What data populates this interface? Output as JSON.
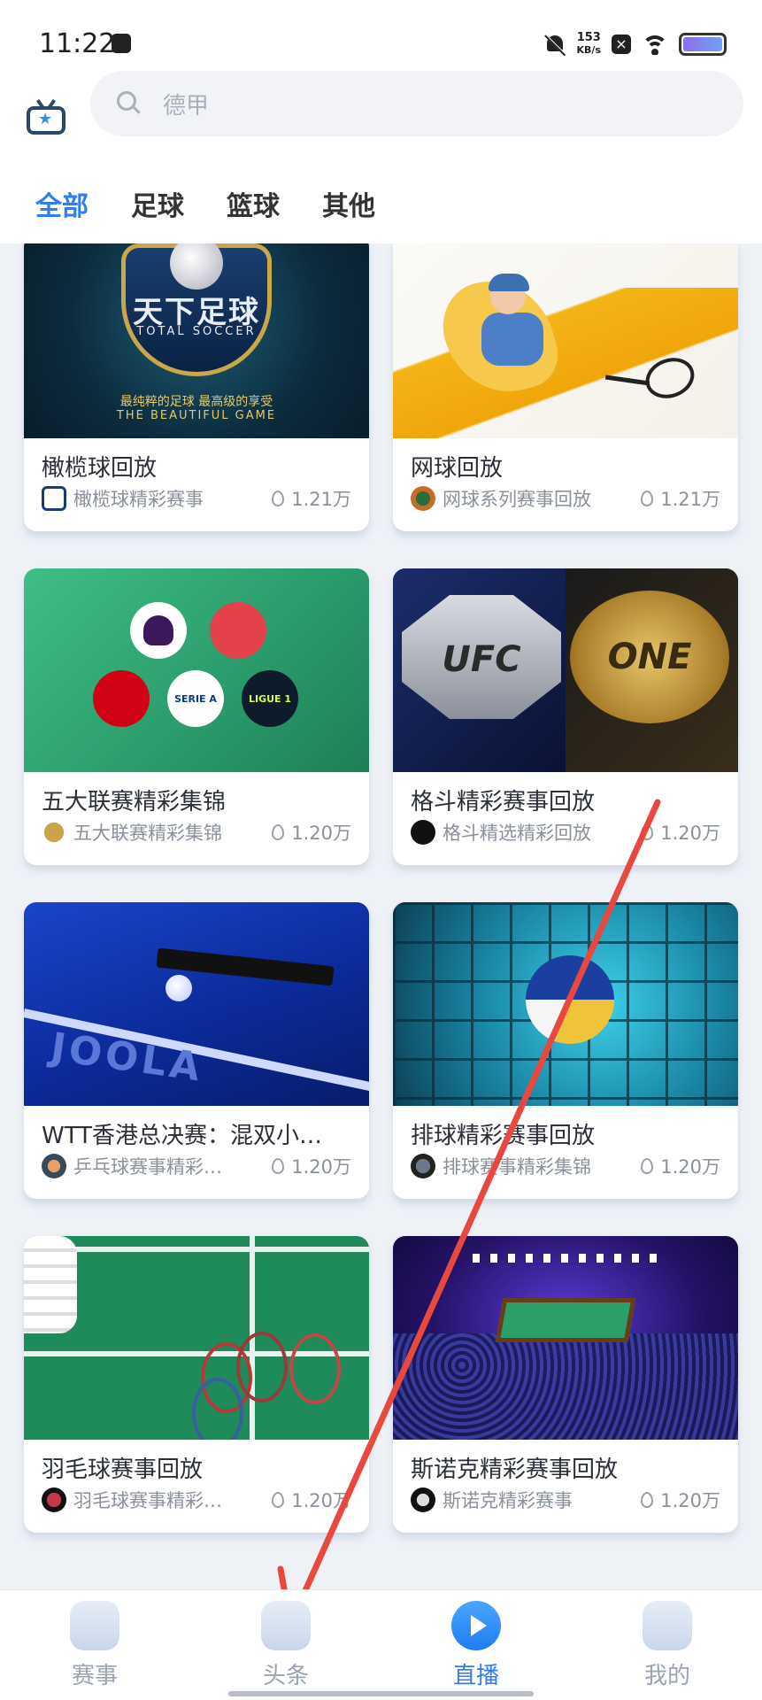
{
  "status_bar": {
    "time": "11:22",
    "speed_value": "153",
    "speed_unit": "KB/s"
  },
  "search": {
    "placeholder": "德甲"
  },
  "tabs": [
    {
      "label": "全部",
      "active": true
    },
    {
      "label": "足球",
      "active": false
    },
    {
      "label": "篮球",
      "active": false
    },
    {
      "label": "其他",
      "active": false
    }
  ],
  "cards": [
    {
      "title": "橄榄球回放",
      "source": "橄榄球精彩赛事",
      "heat": "1.21万",
      "image_text": {
        "main": "天下足球",
        "sub": "最纯粹的足球 最高级的享受",
        "en": "THE BEAUTIFUL GAME",
        "logo": "TOTAL SOCCER"
      }
    },
    {
      "title": "网球回放",
      "source": "网球系列赛事回放",
      "heat": "1.21万"
    },
    {
      "title": "五大联赛精彩集锦",
      "source": "五大联赛精彩集锦",
      "heat": "1.20万",
      "image_text": {
        "seriea": "SERIE A",
        "ligue": "LIGUE 1"
      }
    },
    {
      "title": "格斗精彩赛事回放",
      "source": "格斗精选精彩回放",
      "heat": "1.20万",
      "image_text": {
        "left": "UFC",
        "right": "ONE"
      }
    },
    {
      "title": "WTT香港总决赛：混双小…",
      "source": "乒乓球赛事精彩…",
      "heat": "1.20万",
      "image_text": {
        "brand": "JOOLA"
      }
    },
    {
      "title": "排球精彩赛事回放",
      "source": "排球赛事精彩集锦",
      "heat": "1.20万"
    },
    {
      "title": "羽毛球赛事回放",
      "source": "羽毛球赛事精彩…",
      "heat": "1.20万"
    },
    {
      "title": "斯诺克精彩赛事回放",
      "source": "斯诺克精彩赛事",
      "heat": "1.20万"
    }
  ],
  "bottom_nav": [
    {
      "label": "赛事",
      "icon": "trophy-icon",
      "active": false
    },
    {
      "label": "头条",
      "icon": "news-icon",
      "active": false
    },
    {
      "label": "直播",
      "icon": "play-icon",
      "active": true
    },
    {
      "label": "我的",
      "icon": "profile-icon",
      "active": false
    }
  ],
  "colors": {
    "accent": "#2e7df5",
    "annotation_arrow": "#e8483f"
  }
}
